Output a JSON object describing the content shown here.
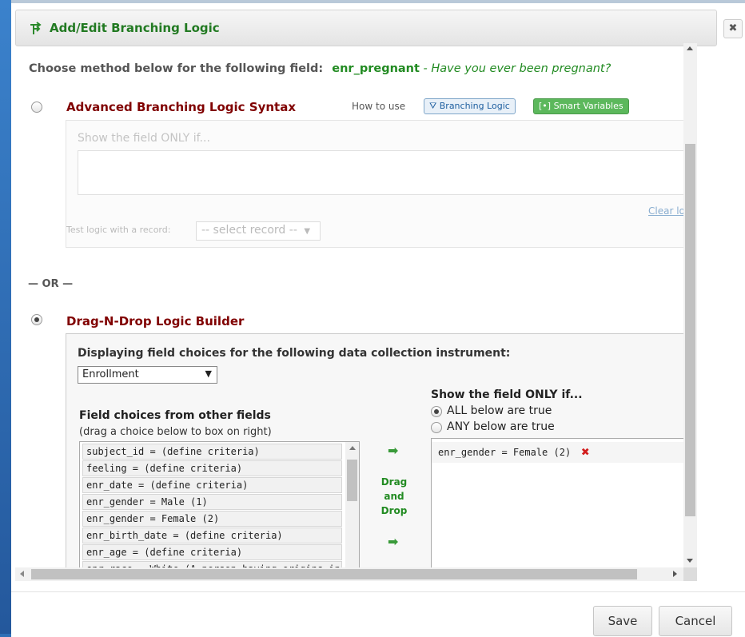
{
  "dialog": {
    "title": "Add/Edit Branching Logic",
    "close_label": "✖"
  },
  "intro": {
    "text": "Choose method below for the following field:",
    "field_name": "enr_pregnant",
    "separator": " - ",
    "field_label": "Have you ever been pregnant?"
  },
  "advanced": {
    "title": "Advanced Branching Logic Syntax",
    "how_to_use": "How to use",
    "branching_logic_button": "Branching Logic",
    "smart_variables_button": "[•] Smart Variables",
    "placeholder_hint": "Show the field ONLY if...",
    "clear_link": "Clear lo",
    "test_label": "Test logic with a record:",
    "select_record": "-- select record --"
  },
  "or_label": "— OR —",
  "dragndrop": {
    "title": "Drag-N-Drop Logic Builder",
    "displaying_text": "Displaying field choices for the following data collection instrument:",
    "instrument_selected": "Enrollment",
    "field_choices_heading": "Field choices from other fields",
    "field_choices_sub": "(drag a choice below to box on right)",
    "field_choices": [
      "subject_id = (define criteria)",
      "feeling = (define criteria)",
      "enr_date = (define criteria)",
      "enr_gender = Male (1)",
      "enr_gender = Female (2)",
      "enr_birth_date = (define criteria)",
      "enr_age = (define criteria)",
      "enr_race = White (A person having origins in"
    ],
    "drag_label": [
      "Drag",
      "and",
      "Drop"
    ],
    "show_heading": "Show the field ONLY if...",
    "all_true": "ALL below are true",
    "any_true": "ANY below are true",
    "logic_mode": "ALL",
    "conditions": [
      "enr_gender = Female (2)"
    ]
  },
  "footer": {
    "save": "Save",
    "cancel": "Cancel"
  }
}
